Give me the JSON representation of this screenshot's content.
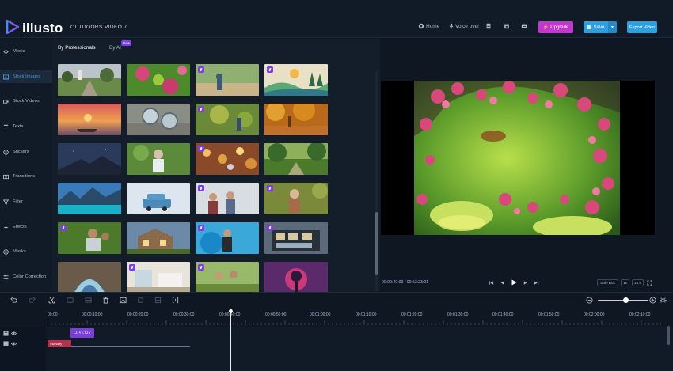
{
  "app": {
    "logo_text": "illusto",
    "project_title": "OUTDOORS VIDEO 7"
  },
  "header": {
    "home_label": "Home",
    "voiceover_label": "Voice over",
    "upgrade_label": "Upgrade",
    "save_label": "Save",
    "export_label": "Export Video"
  },
  "sidebar": {
    "items": [
      {
        "label": "Media",
        "icon": "media-icon"
      },
      {
        "label": "Stock Images",
        "icon": "image-icon",
        "active": true
      },
      {
        "label": "Stock Videos",
        "icon": "video-icon"
      },
      {
        "label": "Texts",
        "icon": "text-icon"
      },
      {
        "label": "Stickers",
        "icon": "sticker-icon"
      },
      {
        "label": "Transitions",
        "icon": "transition-icon"
      },
      {
        "label": "Filter",
        "icon": "filter-icon"
      },
      {
        "label": "Effects",
        "icon": "effects-icon"
      },
      {
        "label": "Masks",
        "icon": "mask-icon"
      },
      {
        "label": "Color Correction",
        "icon": "color-correction-icon"
      }
    ]
  },
  "panel": {
    "tab_professionals": "By Professionals",
    "tab_ai": "By AI",
    "new_badge": "New"
  },
  "preview": {
    "current_time": "00:00:40:09",
    "total_time": "00:53:23:21",
    "safe_box_label": "Safe Box",
    "speed_label": "1x",
    "ratio_label": "16:9"
  },
  "timeline": {
    "ruler_labels": [
      "00:00",
      "00:00:10:00",
      "00:00:20:00",
      "00:00:30:00",
      "00:00:40:00",
      "00:00:50:00",
      "00:01:00:00",
      "00:01:10:00",
      "00:01:20:00",
      "00:01:30:00",
      "00:01:40:00",
      "00:01:50:00",
      "00:02:00:00",
      "00:02:10:00"
    ],
    "text_clip": "LOVE LIV",
    "title_clip": "Monday"
  },
  "colors": {
    "accent": "#2f9fe0",
    "upgrade": "#c238cf",
    "pro_badge": "#7b3fe4",
    "background": "#0d1522"
  }
}
